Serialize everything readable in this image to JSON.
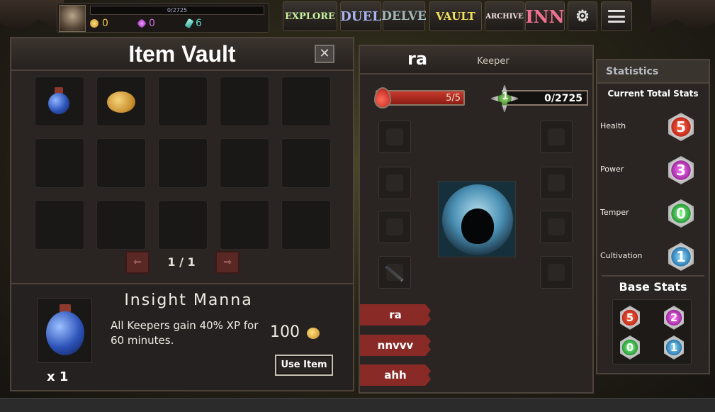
{
  "top_bar": {
    "xp_text": "0/2725",
    "gold": "0",
    "gems": "0",
    "crystals": "6",
    "nav": {
      "explore": "EXPLORE",
      "duel": "DUEL",
      "delve": "DELVE",
      "vault": "VAULT",
      "archive": "ARCHIVE",
      "inn": "INN"
    }
  },
  "vault": {
    "title": "Item Vault",
    "close_label": "✕",
    "slots": [
      {
        "item": "potion"
      },
      {
        "item": "coin"
      },
      {
        "item": ""
      },
      {
        "item": ""
      },
      {
        "item": ""
      },
      {
        "item": ""
      },
      {
        "item": ""
      },
      {
        "item": ""
      },
      {
        "item": ""
      },
      {
        "item": ""
      },
      {
        "item": ""
      },
      {
        "item": ""
      },
      {
        "item": ""
      },
      {
        "item": ""
      },
      {
        "item": ""
      }
    ],
    "page_label": "1 / 1",
    "prev_label": "⇐",
    "next_label": "⇒",
    "selected": {
      "name": "Insight Manna",
      "description": "All Keepers gain 40% XP for 60 minutes.",
      "quantity": "x 1",
      "price": "100",
      "use_label": "Use Item"
    }
  },
  "keeper": {
    "name": "ra",
    "class": "Keeper",
    "health_text": "5/5",
    "health_fraction": 1.0,
    "level": "1",
    "xp_text": "0/2725",
    "roster": [
      "ra",
      "nnvvv",
      "ahh"
    ]
  },
  "stats": {
    "title": "Statistics",
    "current_title": "Current Total Stats",
    "rows": [
      {
        "label": "Health",
        "value": "5"
      },
      {
        "label": "Power",
        "value": "3"
      },
      {
        "label": "Temper",
        "value": "0"
      },
      {
        "label": "Cultivation",
        "value": "1"
      }
    ],
    "base_title": "Base Stats",
    "base": {
      "health": "5",
      "power": "2",
      "temper": "0",
      "cultivation": "1"
    }
  },
  "colors": {
    "panel_bg": "#2a2522",
    "border": "#4d433a",
    "health_red": "#c83a2c",
    "tag_red": "#8a2a26",
    "gold": "#f1c648"
  }
}
